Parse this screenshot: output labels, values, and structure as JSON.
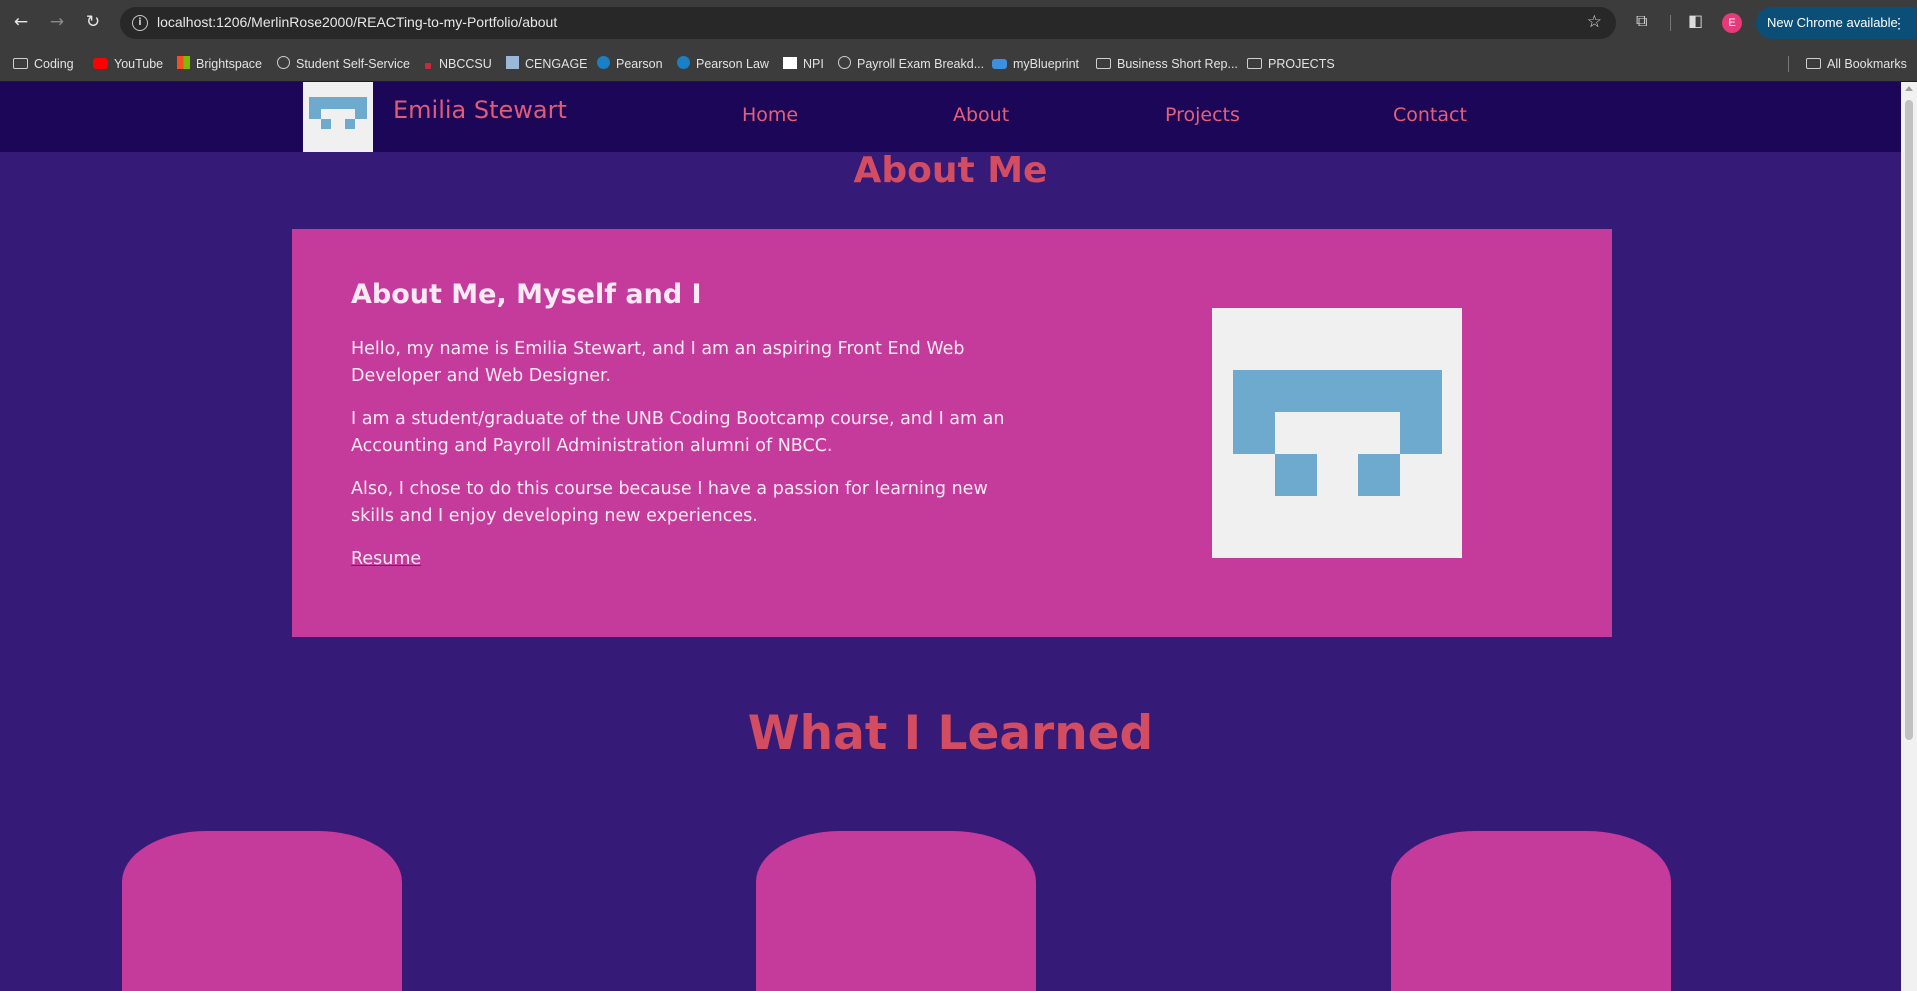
{
  "browser": {
    "url": "localhost:1206/MerlinRose2000/REACTing-to-my-Portfolio/about",
    "profile_initial": "E",
    "update_label": "New Chrome available",
    "bookmarks": [
      {
        "label": "Coding",
        "icon": "folder-icon"
      },
      {
        "label": "YouTube",
        "icon": "youtube-icon"
      },
      {
        "label": "Brightspace",
        "icon": "microsoft-icon"
      },
      {
        "label": "Student Self-Service",
        "icon": "globe-icon"
      },
      {
        "label": "NBCCSU",
        "icon": "nbccsu-icon"
      },
      {
        "label": "CENGAGE",
        "icon": "cengage-icon"
      },
      {
        "label": "Pearson",
        "icon": "pearson-icon"
      },
      {
        "label": "Pearson Law",
        "icon": "pearson-icon"
      },
      {
        "label": "NPI",
        "icon": "npi-icon"
      },
      {
        "label": "Payroll Exam Breakd...",
        "icon": "globe-icon"
      },
      {
        "label": "myBlueprint",
        "icon": "myblueprint-icon"
      },
      {
        "label": "Business Short Rep...",
        "icon": "folder-icon"
      },
      {
        "label": "PROJECTS",
        "icon": "folder-icon"
      }
    ],
    "all_bookmarks_label": "All Bookmarks"
  },
  "site": {
    "brand": "Emilia Stewart",
    "nav": [
      "Home",
      "About",
      "Projects",
      "Contact"
    ],
    "colors": {
      "header_bg": "#1c0657",
      "page_bg": "#361a78",
      "card_bg": "#c53b9c",
      "accent": "#d34d62",
      "logo_blue": "#6eaacd"
    }
  },
  "about": {
    "heading": "About Me",
    "card_title": "About Me, Myself and I",
    "paragraphs": [
      "Hello, my name is Emilia Stewart, and I am an aspiring Front End Web Developer and Web Designer.",
      "I am a student/graduate of the UNB Coding Bootcamp course, and I am an Accounting and Payroll Administration alumni of NBCC.",
      "Also, I chose to do this course because I have a passion for learning new skills and I enjoy developing new experiences."
    ],
    "resume_label": "Resume"
  },
  "learned": {
    "heading": "What I Learned"
  }
}
